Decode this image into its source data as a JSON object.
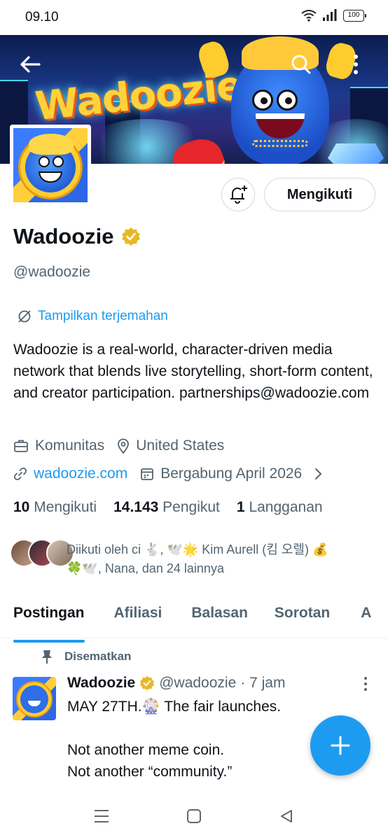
{
  "status_bar": {
    "time": "09.10",
    "battery": "100"
  },
  "banner": {
    "logo_text": "Wadoozie"
  },
  "profile": {
    "follow_button": "Mengikuti",
    "name": "Wadoozie",
    "handle": "@wadoozie",
    "translate_link": "Tampilkan terjemahan",
    "bio": "Wadoozie is a real-world, character-driven media network that blends live storytelling, short-form content, and creator participation. partnerships@wadoozie.com",
    "category": "Komunitas",
    "location": "United States",
    "website": "wadoozie.com",
    "joined": "Bergabung April 2026"
  },
  "stats": {
    "following_count": "10",
    "following_label": "Mengikuti",
    "followers_count": "14.143",
    "followers_label": "Pengikut",
    "subscriptions_count": "1",
    "subscriptions_label": "Langganan"
  },
  "followed_by": {
    "line1": "Diikuti oleh ci 🐇, 🕊️🌟 Kim Aurell (킴 오렐) 💰",
    "line2": "🍀🕊️, Nana, dan 24 lainnya"
  },
  "tabs": [
    {
      "label": "Postingan",
      "active": true
    },
    {
      "label": "Afiliasi"
    },
    {
      "label": "Balasan"
    },
    {
      "label": "Sorotan"
    },
    {
      "label": "A"
    }
  ],
  "pinned_post": {
    "pinned_label": "Disematkan",
    "author_name": "Wadoozie",
    "author_handle": "@wadoozie",
    "time": "· 7 jam",
    "text_line1": "MAY 27TH.🎡 The fair launches.",
    "text_line2": "Not another meme coin.",
    "text_line3": "Not another “community.”"
  },
  "colors": {
    "accent": "#1d9bf0",
    "verified": "#e8b829",
    "text": "#0f1419",
    "muted": "#536471"
  }
}
